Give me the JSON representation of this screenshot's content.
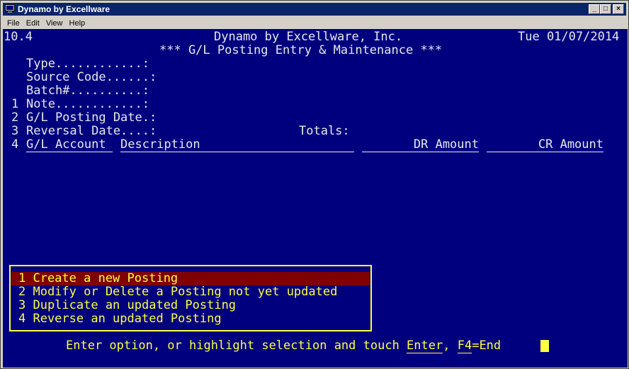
{
  "window": {
    "title": "Dynamo by Excellware",
    "controls": [
      "_",
      "□",
      "×"
    ]
  },
  "menu": [
    "File",
    "Edit",
    "View",
    "Help"
  ],
  "screen": {
    "version": "10.4",
    "company": "Dynamo by Excellware, Inc.",
    "date": "Tue 01/07/2014",
    "heading": "*** G/L Posting Entry & Maintenance ***",
    "fields": [
      {
        "num": "",
        "label": "Type............:"
      },
      {
        "num": "",
        "label": "Source Code......:"
      },
      {
        "num": "",
        "label": "Batch#..........:"
      },
      {
        "num": "1",
        "label": "Note............:"
      },
      {
        "num": "2",
        "label": "G/L Posting Date.:"
      },
      {
        "num": "3",
        "label": "Reversal Date....:"
      }
    ],
    "totals_label": "Totals:",
    "grid": {
      "num": "4",
      "columns": [
        "G/L Account",
        "Description",
        "DR Amount",
        "CR Amount"
      ]
    },
    "options": [
      "1 Create a new Posting",
      "2 Modify or Delete a Posting not yet updated",
      "3 Duplicate an updated Posting",
      "4 Reverse an updated Posting"
    ],
    "selected_option": 1,
    "prompt": {
      "before": "Enter option, or highlight selection and touch ",
      "enter": "Enter",
      "comma": ", ",
      "f4": "F4",
      "after": "=End"
    }
  }
}
